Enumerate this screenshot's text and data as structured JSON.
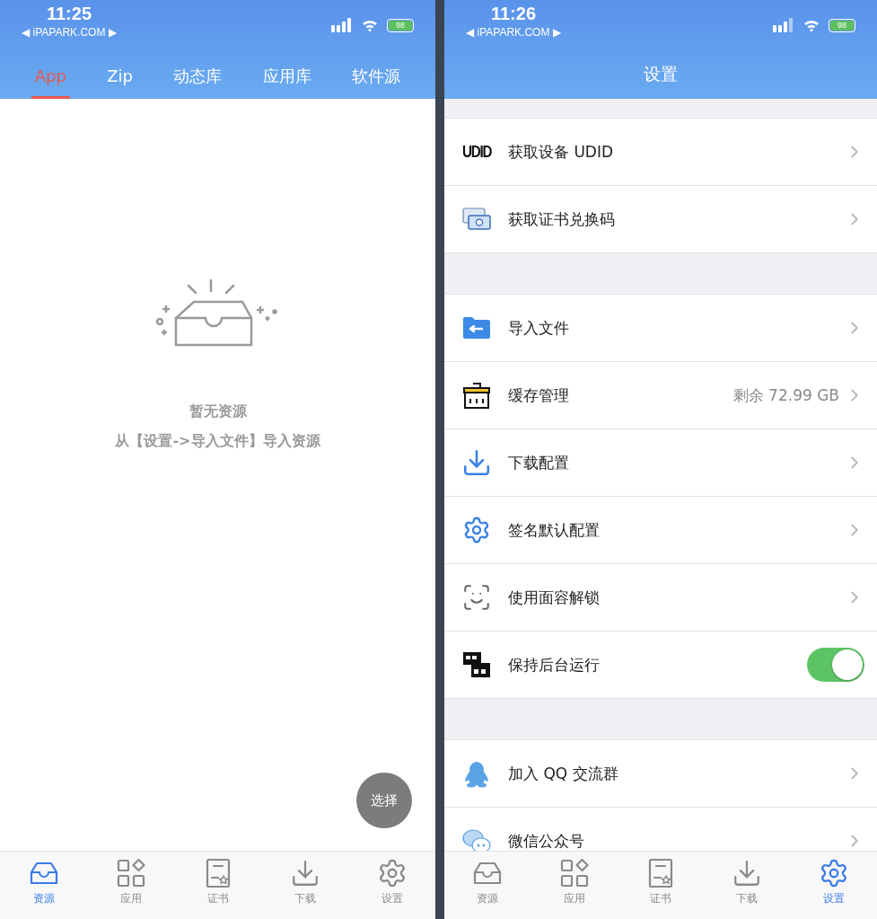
{
  "screens": [
    {
      "status_bar": {
        "time": "11:25",
        "back_link": "◀ iPAPARK.COM ▶",
        "battery": "98"
      },
      "tabs": [
        {
          "label": "App",
          "selected": true
        },
        {
          "label": "Zip",
          "selected": false
        },
        {
          "label": "动态库",
          "selected": false
        },
        {
          "label": "应用库",
          "selected": false
        },
        {
          "label": "软件源",
          "selected": false
        }
      ],
      "empty_state": {
        "title": "暂无资源",
        "hint": "从【设置->导入文件】导入资源"
      },
      "fab": "选择",
      "tab_bar": [
        {
          "label": "资源",
          "selected": true
        },
        {
          "label": "应用",
          "selected": false
        },
        {
          "label": "证书",
          "selected": false
        },
        {
          "label": "下载",
          "selected": false
        },
        {
          "label": "设置",
          "selected": false
        }
      ]
    },
    {
      "status_bar": {
        "time": "11:26",
        "back_link": "◀ iPAPARK.COM ▶",
        "battery": "98"
      },
      "title": "设置",
      "sections": [
        [
          {
            "kind": "link",
            "icon_text": "UDID",
            "label": "获取设备 UDID"
          },
          {
            "kind": "link",
            "label": "获取证书兑换码"
          }
        ],
        [
          {
            "kind": "link",
            "label": "导入文件"
          },
          {
            "kind": "link",
            "label": "缓存管理",
            "value": "剩余 72.99 GB"
          },
          {
            "kind": "link",
            "label": "下载配置"
          },
          {
            "kind": "link",
            "label": "签名默认配置"
          },
          {
            "kind": "link",
            "label": "使用面容解锁"
          },
          {
            "kind": "toggle",
            "label": "保持后台运行",
            "on": true
          }
        ],
        [
          {
            "kind": "link",
            "label": "加入 QQ 交流群"
          },
          {
            "kind": "link",
            "label": "微信公众号"
          }
        ]
      ],
      "tab_bar": [
        {
          "label": "资源",
          "selected": false
        },
        {
          "label": "应用",
          "selected": false
        },
        {
          "label": "证书",
          "selected": false
        },
        {
          "label": "下载",
          "selected": false
        },
        {
          "label": "设置",
          "selected": true
        }
      ]
    }
  ]
}
